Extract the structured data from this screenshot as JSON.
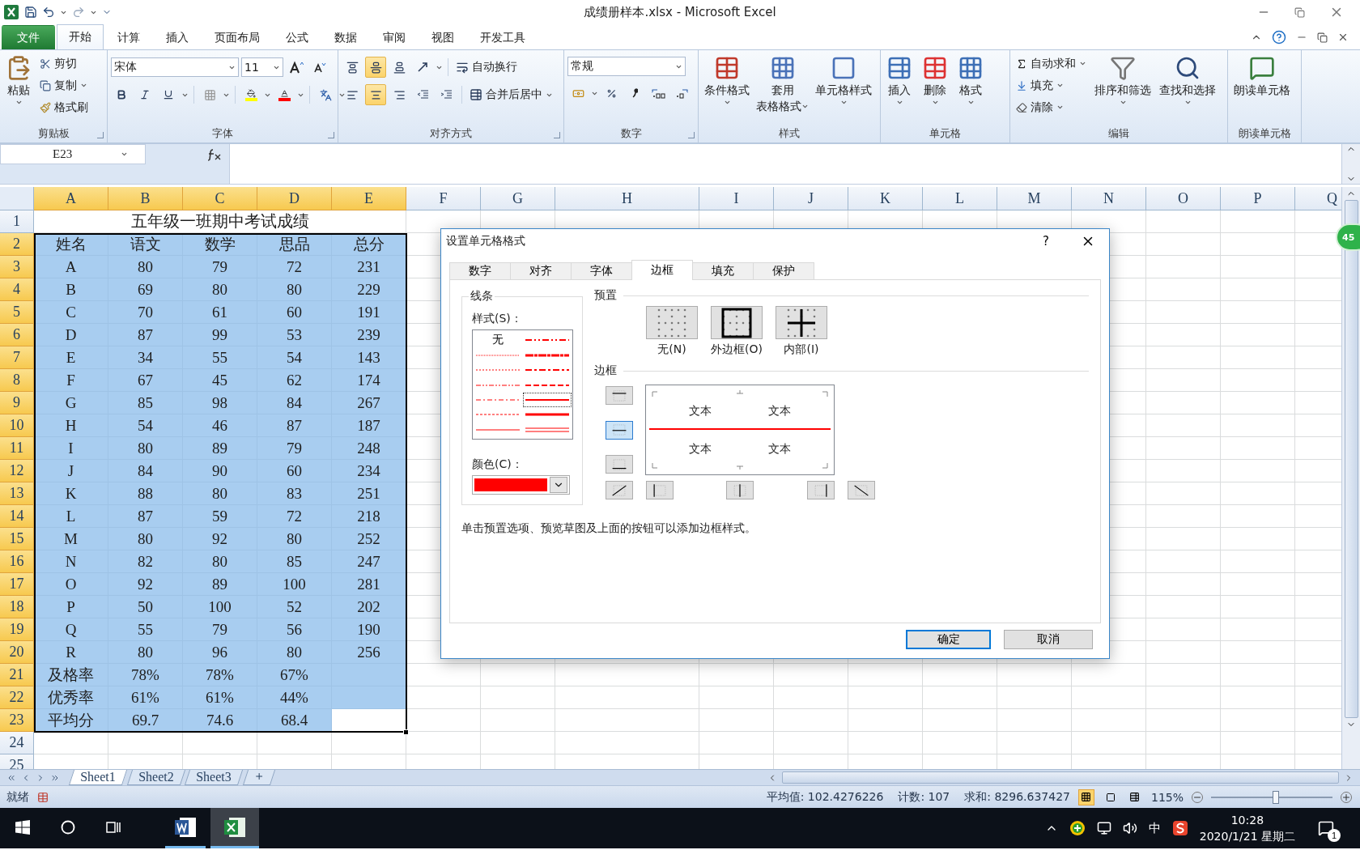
{
  "window": {
    "title": "成绩册样本.xlsx - Microsoft Excel"
  },
  "ribbon_tabs": [
    {
      "label": "文件",
      "kind": "file",
      "selected": false
    },
    {
      "label": "开始",
      "kind": "tab",
      "selected": true
    },
    {
      "label": "计算",
      "kind": "tab",
      "selected": false
    },
    {
      "label": "插入",
      "kind": "tab",
      "selected": false
    },
    {
      "label": "页面布局",
      "kind": "tab",
      "selected": false
    },
    {
      "label": "公式",
      "kind": "tab",
      "selected": false
    },
    {
      "label": "数据",
      "kind": "tab",
      "selected": false
    },
    {
      "label": "审阅",
      "kind": "tab",
      "selected": false
    },
    {
      "label": "视图",
      "kind": "tab",
      "selected": false
    },
    {
      "label": "开发工具",
      "kind": "tab",
      "selected": false
    }
  ],
  "ribbon": {
    "clipboard": {
      "label": "剪贴板",
      "paste": "粘贴",
      "cut": "剪切",
      "copy": "复制",
      "format_painter": "格式刷"
    },
    "font": {
      "label": "字体",
      "font_name": "宋体",
      "font_size": "11"
    },
    "alignment": {
      "label": "对齐方式",
      "vertical": [
        {
          "selected": false
        },
        {
          "selected": true
        },
        {
          "selected": false
        }
      ],
      "horizontal": [
        {
          "selected": false
        },
        {
          "selected": true
        },
        {
          "selected": false
        }
      ],
      "wrap_text": "自动换行",
      "merge_center": "合并后居中"
    },
    "number": {
      "label": "数字",
      "format": "常规"
    },
    "styles": {
      "label": "样式",
      "conditional": "条件格式",
      "table_format": [
        "套用",
        "表格格式"
      ],
      "cell_styles": "单元格样式"
    },
    "cells": {
      "label": "单元格",
      "insert": "插入",
      "delete": "删除",
      "format": "格式"
    },
    "editing": {
      "label": "编辑",
      "autosum": "自动求和",
      "fill": "填充",
      "clear": "清除",
      "sort_filter": "排序和筛选",
      "find_select": "查找和选择"
    },
    "speech": {
      "label": "朗读单元格",
      "read_cells": "朗读单元格"
    }
  },
  "formula_bar": {
    "name_box": "E23"
  },
  "sheet": {
    "columns": [
      {
        "label": "A",
        "selected": true
      },
      {
        "label": "B",
        "selected": true
      },
      {
        "label": "C",
        "selected": true
      },
      {
        "label": "D",
        "selected": true
      },
      {
        "label": "E",
        "selected": true
      },
      {
        "label": "F",
        "selected": false
      },
      {
        "label": "G",
        "selected": false
      },
      {
        "label": "H",
        "selected": false
      },
      {
        "label": "I",
        "selected": false
      },
      {
        "label": "J",
        "selected": false
      },
      {
        "label": "K",
        "selected": false
      },
      {
        "label": "L",
        "selected": false
      },
      {
        "label": "M",
        "selected": false
      },
      {
        "label": "N",
        "selected": false
      },
      {
        "label": "O",
        "selected": false
      },
      {
        "label": "P",
        "selected": false
      },
      {
        "label": "Q",
        "selected": false
      }
    ],
    "rows": [
      {
        "header": "1",
        "selected": false,
        "title": "五年级一班期中考试成绩"
      },
      {
        "header": "2",
        "selected": true,
        "cells": [
          "姓名",
          "语文",
          "数学",
          "思品",
          "总分"
        ]
      },
      {
        "header": "3",
        "selected": true,
        "cells": [
          "A",
          "80",
          "79",
          "72",
          "231"
        ]
      },
      {
        "header": "4",
        "selected": true,
        "cells": [
          "B",
          "69",
          "80",
          "80",
          "229"
        ]
      },
      {
        "header": "5",
        "selected": true,
        "cells": [
          "C",
          "70",
          "61",
          "60",
          "191"
        ]
      },
      {
        "header": "6",
        "selected": true,
        "cells": [
          "D",
          "87",
          "99",
          "53",
          "239"
        ]
      },
      {
        "header": "7",
        "selected": true,
        "cells": [
          "E",
          "34",
          "55",
          "54",
          "143"
        ]
      },
      {
        "header": "8",
        "selected": true,
        "cells": [
          "F",
          "67",
          "45",
          "62",
          "174"
        ]
      },
      {
        "header": "9",
        "selected": true,
        "cells": [
          "G",
          "85",
          "98",
          "84",
          "267"
        ]
      },
      {
        "header": "10",
        "selected": true,
        "cells": [
          "H",
          "54",
          "46",
          "87",
          "187"
        ]
      },
      {
        "header": "11",
        "selected": true,
        "cells": [
          "I",
          "80",
          "89",
          "79",
          "248"
        ]
      },
      {
        "header": "12",
        "selected": true,
        "cells": [
          "J",
          "84",
          "90",
          "60",
          "234"
        ]
      },
      {
        "header": "13",
        "selected": true,
        "cells": [
          "K",
          "88",
          "80",
          "83",
          "251"
        ]
      },
      {
        "header": "14",
        "selected": true,
        "cells": [
          "L",
          "87",
          "59",
          "72",
          "218"
        ]
      },
      {
        "header": "15",
        "selected": true,
        "cells": [
          "M",
          "80",
          "92",
          "80",
          "252"
        ]
      },
      {
        "header": "16",
        "selected": true,
        "cells": [
          "N",
          "82",
          "80",
          "85",
          "247"
        ]
      },
      {
        "header": "17",
        "selected": true,
        "cells": [
          "O",
          "92",
          "89",
          "100",
          "281"
        ]
      },
      {
        "header": "18",
        "selected": true,
        "cells": [
          "P",
          "50",
          "100",
          "52",
          "202"
        ]
      },
      {
        "header": "19",
        "selected": true,
        "cells": [
          "Q",
          "55",
          "79",
          "56",
          "190"
        ]
      },
      {
        "header": "20",
        "selected": true,
        "cells": [
          "R",
          "80",
          "96",
          "80",
          "256"
        ]
      },
      {
        "header": "21",
        "selected": true,
        "cells": [
          "及格率",
          "78%",
          "78%",
          "67%",
          null
        ]
      },
      {
        "header": "22",
        "selected": true,
        "cells": [
          "优秀率",
          "61%",
          "61%",
          "44%",
          null
        ]
      },
      {
        "header": "23",
        "selected": true,
        "cells": [
          "平均分",
          "69.7",
          "74.6",
          "68.4",
          null
        ],
        "active": [
          false,
          false,
          false,
          false,
          true
        ]
      },
      {
        "header": "24",
        "selected": false
      },
      {
        "header": "25",
        "selected": false
      }
    ]
  },
  "side_badge": "45",
  "dialog": {
    "title": "设置单元格格式",
    "help": "?",
    "tabs": [
      {
        "label": "数字",
        "selected": false
      },
      {
        "label": "对齐",
        "selected": false
      },
      {
        "label": "字体",
        "selected": false
      },
      {
        "label": "边框",
        "selected": true
      },
      {
        "label": "填充",
        "selected": false
      },
      {
        "label": "保护",
        "selected": false
      }
    ],
    "line": {
      "label": "线条",
      "style_label": "样式(S)：",
      "color_label": "颜色(C)：",
      "color": "#ff0000",
      "styles": [
        {
          "kind": "none",
          "label": "无",
          "selected": false
        },
        {
          "kind": "hair",
          "selected": false
        },
        {
          "kind": "dotted",
          "selected": false
        },
        {
          "kind": "dash_dot_dot",
          "selected": false
        },
        {
          "kind": "dash_dot",
          "selected": false
        },
        {
          "kind": "dashed",
          "selected": false
        },
        {
          "kind": "thin",
          "selected": false
        },
        {
          "kind": "medium_dash_dot_dot",
          "selected": false
        },
        {
          "kind": "slant_dash_dot",
          "selected": false
        },
        {
          "kind": "medium_dash_dot",
          "selected": false
        },
        {
          "kind": "medium_dashed",
          "selected": false
        },
        {
          "kind": "medium",
          "selected": true
        },
        {
          "kind": "thick",
          "selected": false
        },
        {
          "kind": "double",
          "selected": false
        }
      ]
    },
    "presets": {
      "label": "预置",
      "buttons": [
        {
          "kind": "none",
          "label": "无(N)"
        },
        {
          "kind": "outline",
          "label": "外边框(O)"
        },
        {
          "kind": "inside",
          "label": "内部(I)"
        }
      ]
    },
    "border": {
      "label": "边框",
      "preview_texts": [
        "文本",
        "文本",
        "文本",
        "文本"
      ],
      "buttons": [
        {
          "kind": "top",
          "selected": false
        },
        {
          "kind": "middle",
          "selected": true
        },
        {
          "kind": "bottom",
          "selected": false
        },
        {
          "kind": "diagonal_up",
          "selected": false
        },
        {
          "kind": "left",
          "selected": false
        },
        {
          "kind": "center",
          "selected": false
        },
        {
          "kind": "right",
          "selected": false
        },
        {
          "kind": "diagonal_down",
          "selected": false
        }
      ]
    },
    "hint": "单击预置选项、预览草图及上面的按钮可以添加边框样式。",
    "buttons": [
      {
        "label": "确定",
        "kind": "default"
      },
      {
        "label": "取消",
        "kind": "normal"
      }
    ]
  },
  "sheet_tabs": [
    {
      "label": "Sheet1",
      "selected": true
    },
    {
      "label": "Sheet2",
      "selected": false
    },
    {
      "label": "Sheet3",
      "selected": false
    }
  ],
  "status_bar": {
    "ready": "就绪",
    "average": "平均值: 102.4276226",
    "count": "计数: 107",
    "sum": "求和: 8296.637427",
    "views": [
      {
        "selected": true
      },
      {
        "selected": false
      },
      {
        "selected": false
      }
    ],
    "zoom": "115%",
    "zoom_slider": {
      "level": 0.53
    }
  },
  "taskbar": {
    "apps": [
      {
        "kind": "word",
        "selected": false
      },
      {
        "kind": "excel",
        "selected": true
      }
    ],
    "ime": "中",
    "time": "10:28",
    "date": "2020/1/21 星期二",
    "notifications": "1"
  }
}
